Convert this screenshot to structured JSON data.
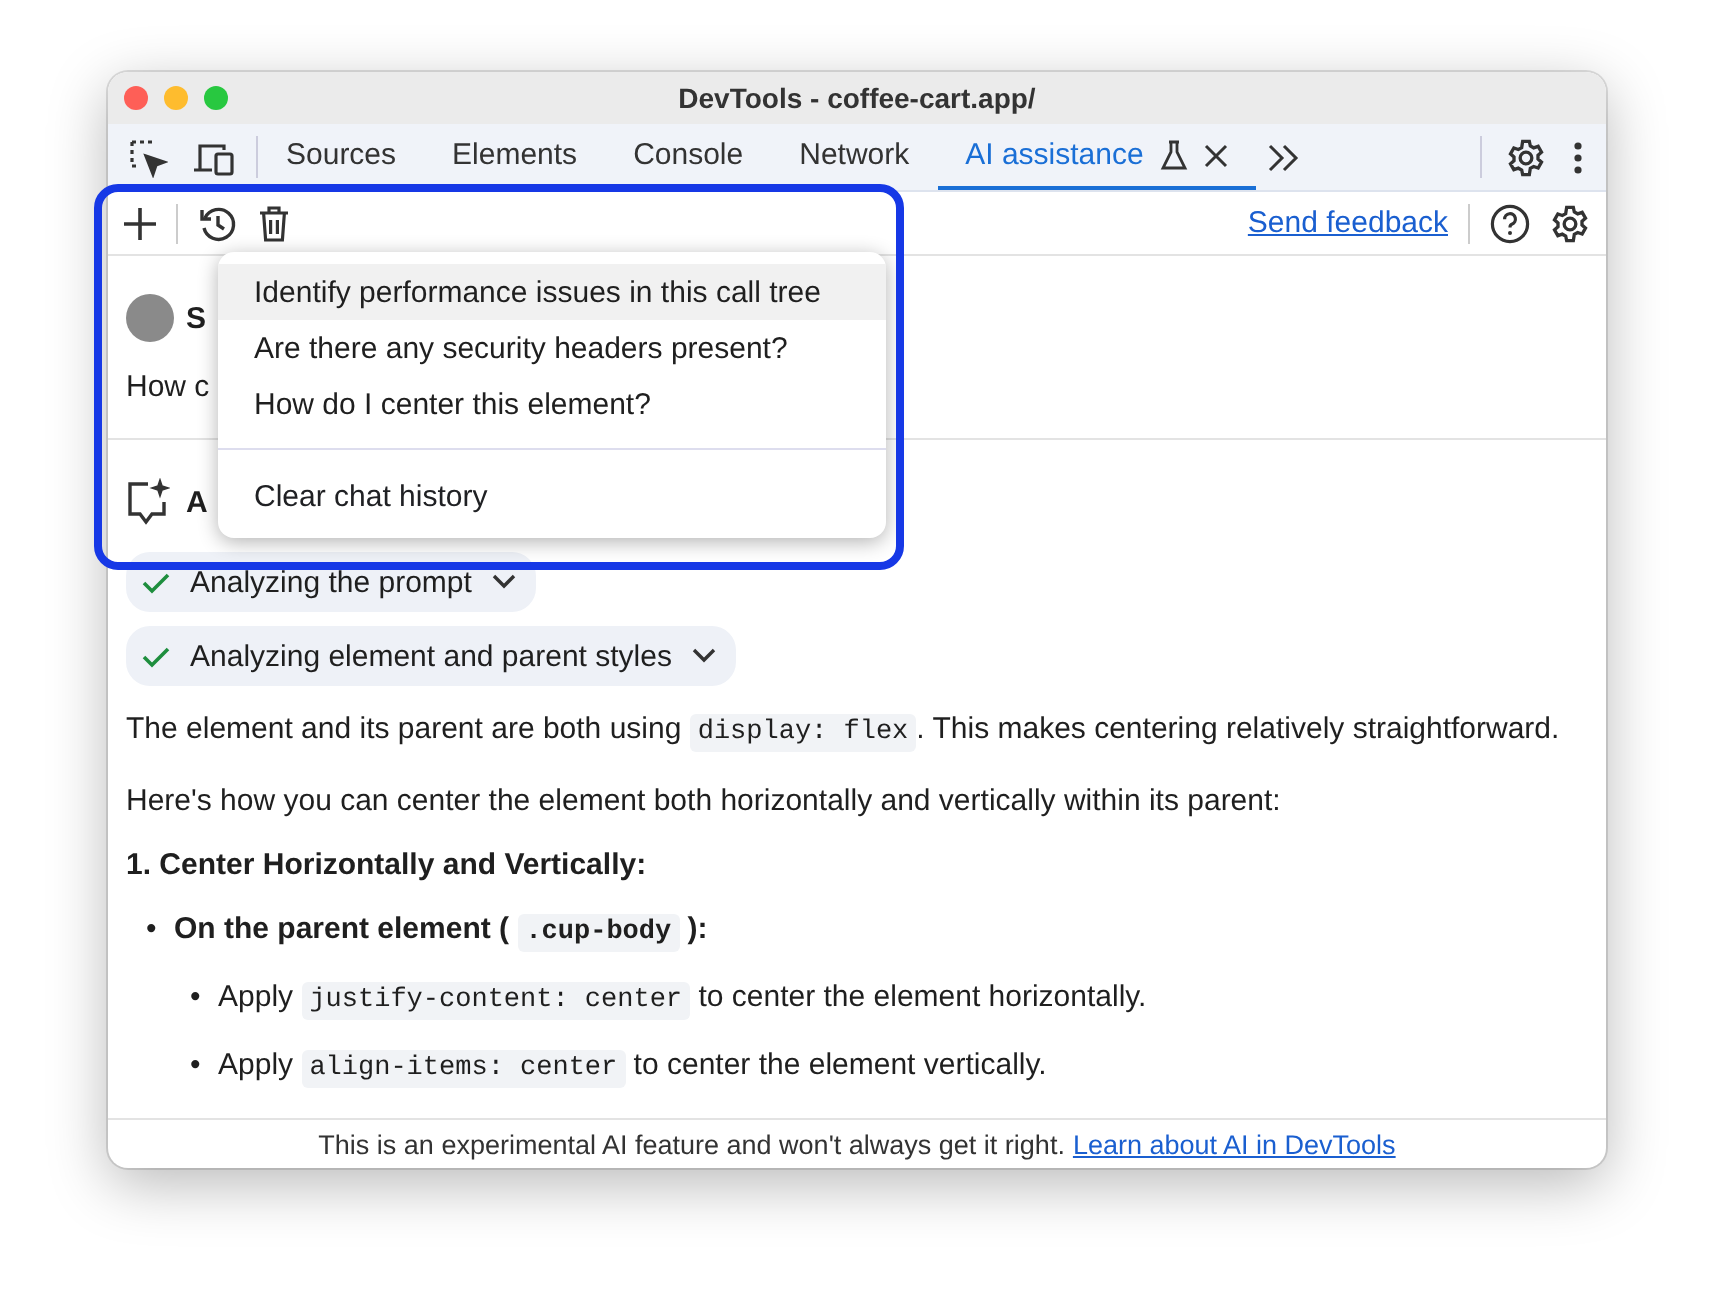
{
  "window": {
    "title": "DevTools - coffee-cart.app/"
  },
  "tabs": [
    {
      "label": "Sources",
      "selected": false,
      "experimental": false,
      "closable": false
    },
    {
      "label": "Elements",
      "selected": false,
      "experimental": false,
      "closable": false
    },
    {
      "label": "Console",
      "selected": false,
      "experimental": false,
      "closable": false
    },
    {
      "label": "Network",
      "selected": false,
      "experimental": false,
      "closable": false
    },
    {
      "label": "AI assistance",
      "selected": true,
      "experimental": true,
      "closable": true
    }
  ],
  "toolbar": {
    "send_feedback": "Send feedback"
  },
  "chat": {
    "user_name": "S",
    "user_message": "How c",
    "ai_name": "A",
    "steps": [
      {
        "label": "Analyzing the prompt",
        "done": true
      },
      {
        "label": "Analyzing element and parent styles",
        "done": true
      }
    ],
    "answer": [
      {
        "kind": "paragraph",
        "segments": [
          {
            "kind": "text",
            "text": "The element and its parent are both using "
          },
          {
            "kind": "code",
            "text": "display: flex"
          },
          {
            "kind": "text",
            "text": ". This makes centering relatively straightforward."
          }
        ]
      },
      {
        "kind": "paragraph",
        "segments": [
          {
            "kind": "text",
            "text": "Here's how you can center the element both horizontally and vertically within its parent:"
          }
        ]
      },
      {
        "kind": "heading",
        "segments": [
          {
            "kind": "text",
            "text": "1. Center Horizontally and Vertically:"
          }
        ]
      },
      {
        "kind": "bullet",
        "bold": true,
        "marker": "•",
        "segments": [
          {
            "kind": "text",
            "text": "On the parent element ( "
          },
          {
            "kind": "code",
            "text": ".cup-body"
          },
          {
            "kind": "text",
            "text": " ):"
          }
        ],
        "children": [
          {
            "kind": "bullet",
            "bold": false,
            "marker": "•",
            "segments": [
              {
                "kind": "text",
                "text": "Apply "
              },
              {
                "kind": "code",
                "text": "justify-content: center"
              },
              {
                "kind": "text",
                "text": " to center the element horizontally."
              }
            ]
          },
          {
            "kind": "bullet",
            "bold": false,
            "marker": "•",
            "segments": [
              {
                "kind": "text",
                "text": "Apply "
              },
              {
                "kind": "code",
                "text": "align-items: center"
              },
              {
                "kind": "text",
                "text": " to center the element vertically."
              }
            ]
          }
        ]
      }
    ]
  },
  "history_menu": {
    "items": [
      {
        "kind": "suggestion",
        "label": "Identify performance issues in this call tree",
        "selected": true
      },
      {
        "kind": "suggestion",
        "label": "Are there any security headers present?",
        "selected": false
      },
      {
        "kind": "suggestion",
        "label": "How do I center this element?",
        "selected": false
      },
      {
        "kind": "action",
        "label": "Clear chat history",
        "selected": false
      }
    ]
  },
  "footer": {
    "text": "This is an experimental AI feature and won't always get it right.",
    "link": "Learn about AI in DevTools"
  }
}
